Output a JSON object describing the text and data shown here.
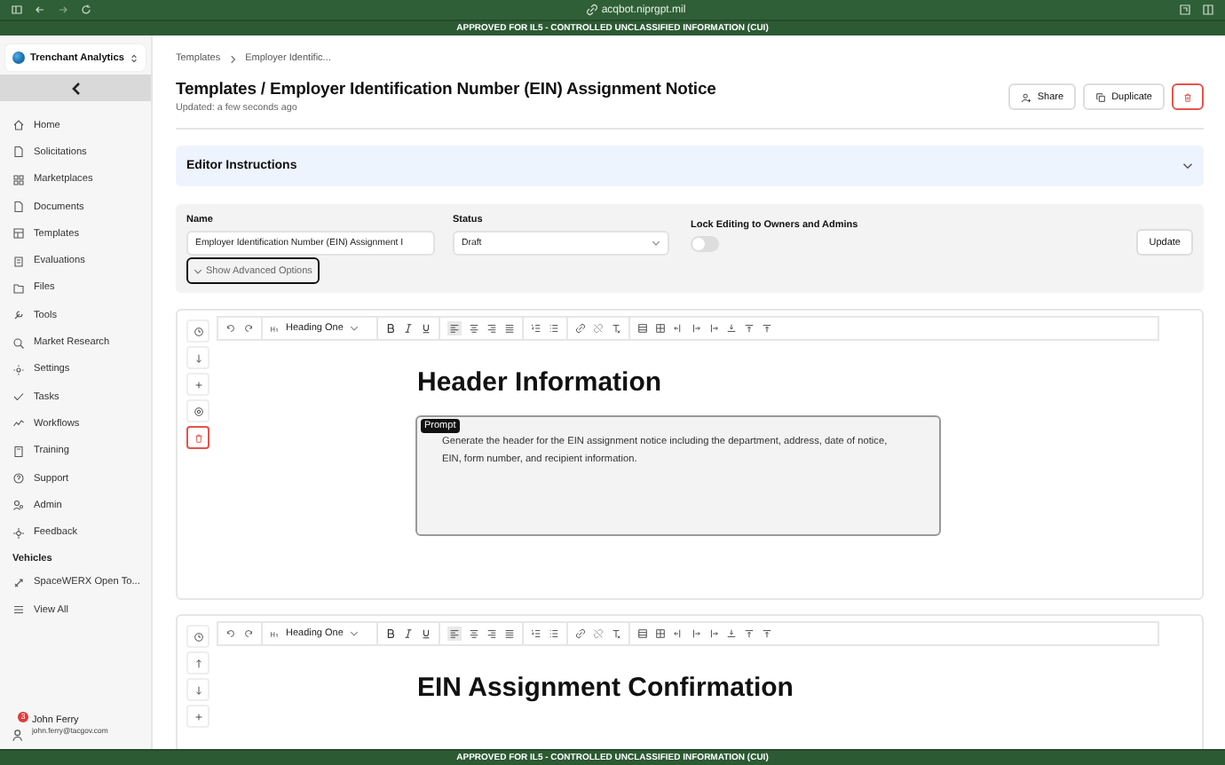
{
  "browser": {
    "url": "acqbot.niprgpt.mil"
  },
  "banner_top": "APPROVED FOR IL5 - CONTROLLED UNCLASSIFIED INFORMATION (CUI)",
  "sidebar": {
    "org": "Trenchant Analytics",
    "items": [
      {
        "label": "Home",
        "selected": false
      },
      {
        "label": "Solicitations",
        "selected": false
      },
      {
        "label": "Marketplaces",
        "selected": false
      },
      {
        "label": "Documents",
        "selected": false
      },
      {
        "label": "Templates",
        "selected": false
      },
      {
        "label": "Evaluations",
        "selected": false
      },
      {
        "label": "Files",
        "selected": false
      },
      {
        "label": "Tools",
        "selected": false
      },
      {
        "label": "Market Research",
        "selected": false
      },
      {
        "label": "Settings",
        "selected": false
      },
      {
        "label": "Tasks",
        "selected": false
      },
      {
        "label": "Workflows",
        "selected": false
      },
      {
        "label": "Training",
        "selected": false
      },
      {
        "label": "Support",
        "selected": false
      },
      {
        "label": "Admin",
        "selected": false
      },
      {
        "label": "Feedback",
        "selected": false
      }
    ],
    "section": "Vehicles",
    "vehicles": [
      {
        "label": "SpaceWERX Open To..."
      },
      {
        "label": "View All"
      }
    ],
    "user": {
      "name": "John Ferry",
      "email": "john.ferry@tacgov.com",
      "badge": "3"
    }
  },
  "breadcrumb": [
    "Templates",
    "Employer Identific..."
  ],
  "title": "Templates / Employer Identification Number (EIN) Assignment Notice",
  "updated": "Updated: a few seconds ago",
  "actions": {
    "share": "Share",
    "duplicate": "Duplicate"
  },
  "instructions": {
    "title": "Editor Instructions",
    "expanded": false
  },
  "form": {
    "name_label": "Name",
    "name_value": "Employer Identification Number (EIN) Assignment I",
    "status_label": "Status",
    "status_value": "Draft",
    "lock_label": "Lock Editing to Owners and Admins",
    "lock_on": false,
    "advanced": "Show Advanced Options",
    "update": "Update"
  },
  "blocks": [
    {
      "heading_style": "Heading One",
      "heading": "Header Information",
      "prompt_label": "Prompt",
      "prompt": "Generate the header for the EIN assignment notice including the department, address, date of notice, EIN, form number, and recipient information."
    },
    {
      "heading_style": "Heading One",
      "heading": "EIN Assignment Confirmation"
    }
  ],
  "banner_bottom": "APPROVED FOR IL5 - CONTROLLED UNCLASSIFIED INFORMATION (CUI)"
}
